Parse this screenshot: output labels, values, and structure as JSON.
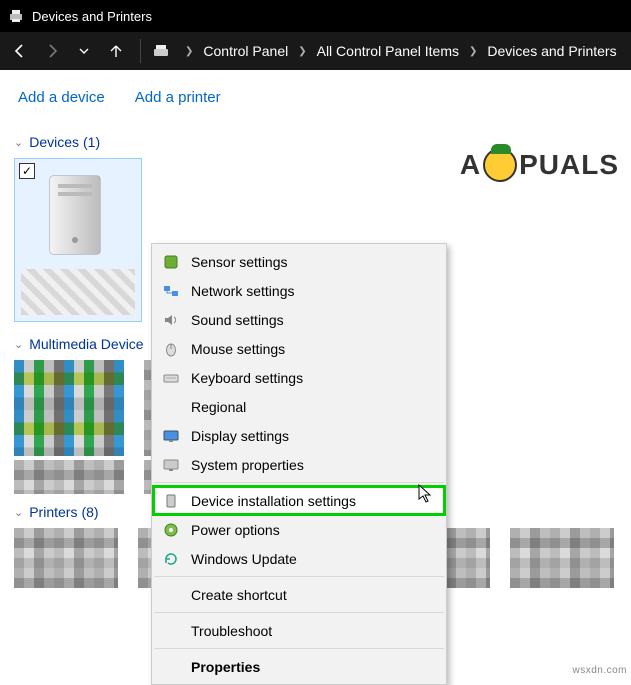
{
  "titlebar": {
    "title": "Devices and Printers"
  },
  "nav": {
    "back": "←",
    "forward": "→",
    "recent": "⌄",
    "up": "↑",
    "crumbs": [
      "Control Panel",
      "All Control Panel Items",
      "Devices and Printers"
    ]
  },
  "cmdbar": {
    "add_device": "Add a device",
    "add_printer": "Add a printer"
  },
  "sections": {
    "devices": {
      "label": "Devices",
      "count": "(1)"
    },
    "multimedia": {
      "label": "Multimedia Device",
      "count": ""
    },
    "printers": {
      "label": "Printers",
      "count": "(8)"
    }
  },
  "context_menu": {
    "items": [
      {
        "icon": "sensor-icon",
        "label": "Sensor settings"
      },
      {
        "icon": "network-icon",
        "label": "Network settings"
      },
      {
        "icon": "sound-icon",
        "label": "Sound settings"
      },
      {
        "icon": "mouse-icon",
        "label": "Mouse settings"
      },
      {
        "icon": "keyboard-icon",
        "label": "Keyboard settings"
      },
      {
        "icon": "",
        "label": "Regional"
      },
      {
        "icon": "display-icon",
        "label": "Display settings"
      },
      {
        "icon": "system-icon",
        "label": "System properties"
      },
      {
        "sep": true
      },
      {
        "icon": "tower-icon",
        "label": "Device installation settings",
        "highlight": true
      },
      {
        "icon": "power-icon",
        "label": "Power options"
      },
      {
        "icon": "update-icon",
        "label": "Windows Update"
      },
      {
        "sep": true
      },
      {
        "icon": "",
        "label": "Create shortcut"
      },
      {
        "sep": true
      },
      {
        "icon": "",
        "label": "Troubleshoot"
      },
      {
        "sep": true
      },
      {
        "icon": "",
        "label": "Properties",
        "bold": true
      }
    ]
  },
  "watermark": {
    "pre": "A",
    "post": "PUALS"
  },
  "credit": "wsxdn.com"
}
